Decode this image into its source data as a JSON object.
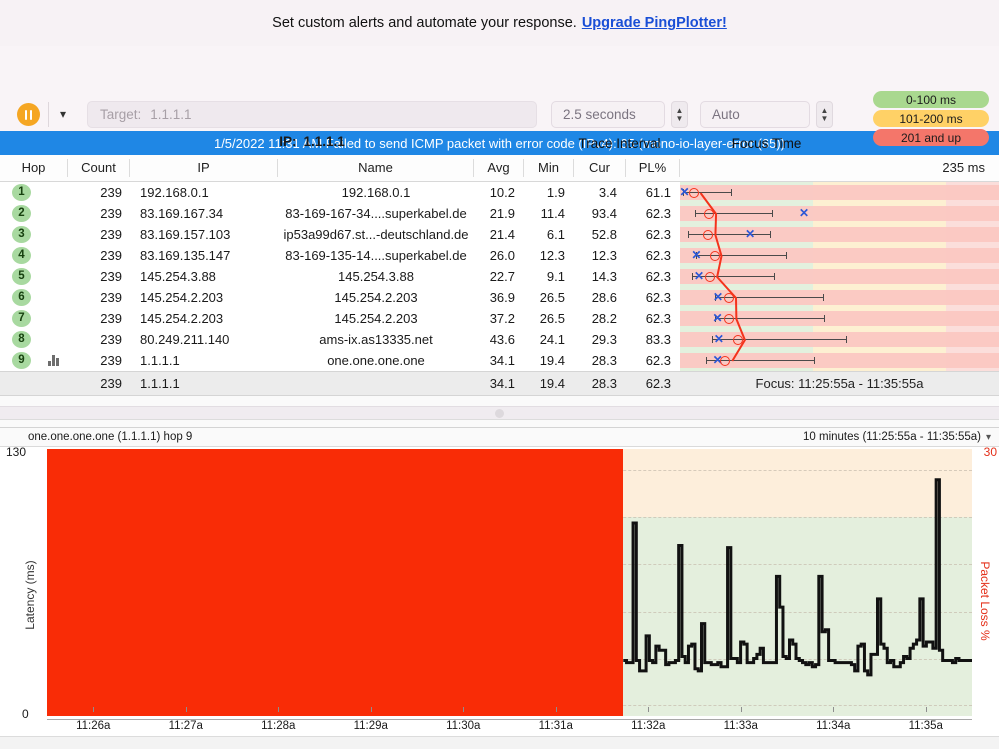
{
  "promo": {
    "text": "Set custom alerts and automate your response.",
    "link": "Upgrade PingPlotter!"
  },
  "toolbar": {
    "pause_icon": "pause-icon",
    "dropdown_icon": "chevron-down-icon",
    "target_label": "Target:",
    "target_placeholder": "1.1.1.1",
    "target_value": "",
    "ip_label": "IP:",
    "ip_value": "1.1.1.1",
    "trace_interval_value": "2.5 seconds",
    "trace_interval_label": "Trace Interval",
    "focus_time_value": "Auto",
    "focus_time_label": "Focus Time",
    "legend": [
      {
        "label": "0-100 ms",
        "color": "#a9d88f"
      },
      {
        "label": "101-200 ms",
        "color": "#ffd166"
      },
      {
        "label": "201 and up",
        "color": "#f4766a"
      }
    ]
  },
  "alert": {
    "message": "1/5/2022 11:31 AM Failed to send ICMP packet with error code (IPv4): 65 (mono-io-layer-error (65))",
    "color": "#1f87e5"
  },
  "table": {
    "columns": [
      "Hop",
      "Count",
      "IP",
      "Name",
      "Avg",
      "Min",
      "Cur",
      "PL%"
    ],
    "scale_label": "235 ms",
    "scale_max_ms": 235,
    "rows": [
      {
        "hop": "1",
        "count": "239",
        "ip": "192.168.0.1",
        "name": "192.168.0.1",
        "avg": "10.2",
        "min": "1.9",
        "cur": "3.4",
        "pl": "61.1"
      },
      {
        "hop": "2",
        "count": "239",
        "ip": "83.169.167.34",
        "name": "83-169-167-34....superkabel.de",
        "avg": "21.9",
        "min": "11.4",
        "cur": "93.4",
        "pl": "62.3"
      },
      {
        "hop": "3",
        "count": "239",
        "ip": "83.169.157.103",
        "name": "ip53a99d67.st...-deutschland.de",
        "avg": "21.4",
        "min": "6.1",
        "cur": "52.8",
        "pl": "62.3"
      },
      {
        "hop": "4",
        "count": "239",
        "ip": "83.169.135.147",
        "name": "83-169-135-14....superkabel.de",
        "avg": "26.0",
        "min": "12.3",
        "cur": "12.3",
        "pl": "62.3"
      },
      {
        "hop": "5",
        "count": "239",
        "ip": "145.254.3.88",
        "name": "145.254.3.88",
        "avg": "22.7",
        "min": "9.1",
        "cur": "14.3",
        "pl": "62.3"
      },
      {
        "hop": "6",
        "count": "239",
        "ip": "145.254.2.203",
        "name": "145.254.2.203",
        "avg": "36.9",
        "min": "26.5",
        "cur": "28.6",
        "pl": "62.3"
      },
      {
        "hop": "7",
        "count": "239",
        "ip": "145.254.2.203",
        "name": "145.254.2.203",
        "avg": "37.2",
        "min": "26.5",
        "cur": "28.2",
        "pl": "62.3"
      },
      {
        "hop": "8",
        "count": "239",
        "ip": "80.249.211.140",
        "name": "ams-ix.as13335.net",
        "avg": "43.6",
        "min": "24.1",
        "cur": "29.3",
        "pl": "83.3"
      },
      {
        "hop": "9",
        "count": "239",
        "ip": "1.1.1.1",
        "name": "one.one.one.one",
        "avg": "34.1",
        "min": "19.4",
        "cur": "28.3",
        "pl": "62.3"
      }
    ],
    "summary": {
      "count": "239",
      "ip": "1.1.1.1",
      "avg": "34.1",
      "min": "19.4",
      "cur": "28.3",
      "pl": "62.3",
      "focus": "Focus: 11:25:55a - 11:35:55a"
    }
  },
  "chart_header": {
    "title": "one.one.one.one (1.1.1.1) hop 9",
    "range": "10 minutes (11:25:55a - 11:35:55a)",
    "caret_icon": "chevron-down-icon"
  },
  "chart_data": {
    "type": "line",
    "title": "one.one.one.one (1.1.1.1) hop 9",
    "xlabel": "",
    "ylabel": "Latency (ms)",
    "y2label": "Packet Loss %",
    "ylim": [
      0,
      130
    ],
    "y2lim": [
      0,
      30
    ],
    "ytick_labels": [
      "130",
      "0"
    ],
    "y2tick_labels": [
      "30"
    ],
    "xtick_labels": [
      "11:26a",
      "11:27a",
      "11:28a",
      "11:29a",
      "11:30a",
      "11:31a",
      "11:32a",
      "11:33a",
      "11:34a",
      "11:35a"
    ],
    "grid": true,
    "packet_loss_block": {
      "from": "11:25:55a",
      "to": "11:32:10a",
      "value": 100,
      "color": "#f92c06"
    },
    "bands": [
      {
        "name": "warn",
        "from": 97,
        "to": 130,
        "color": "#fdeedb"
      },
      {
        "name": "ok",
        "from": 0,
        "to": 97,
        "color": "#e4efdd"
      }
    ],
    "series": [
      {
        "name": "Latency (ms)",
        "color": "#111111",
        "values": [
          27,
          26,
          26,
          94,
          27,
          22,
          22,
          39,
          27,
          26,
          34,
          32,
          32,
          25,
          26,
          26,
          27,
          83,
          29,
          26,
          34,
          35,
          23,
          22,
          45,
          26,
          26,
          25,
          25,
          26,
          24,
          24,
          82,
          28,
          28,
          26,
          36,
          35,
          26,
          26,
          28,
          30,
          33,
          26,
          26,
          26,
          26,
          68,
          53,
          29,
          28,
          37,
          35,
          28,
          27,
          26,
          25,
          26,
          24,
          25,
          68,
          41,
          42,
          27,
          27,
          26,
          26,
          26,
          26,
          26,
          25,
          22,
          34,
          35,
          22,
          20,
          30,
          30,
          57,
          35,
          33,
          26,
          27,
          24,
          24,
          26,
          29,
          28,
          33,
          35,
          37,
          57,
          34,
          36,
          36,
          33,
          115,
          32,
          27,
          27,
          27,
          26,
          28,
          27,
          27,
          27,
          27
        ]
      }
    ]
  }
}
